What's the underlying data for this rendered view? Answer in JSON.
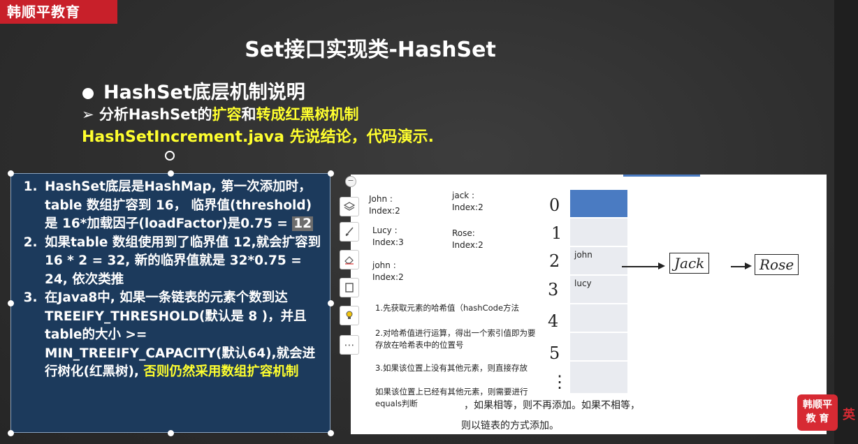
{
  "brand": {
    "logo_text": "韩顺平教育",
    "watermark_line1": "韩顺平",
    "watermark_line2": "教 育",
    "watermark_side": "英"
  },
  "slide": {
    "title": "Set接口实现类-HashSet",
    "bullet": "HashSet底层机制说明",
    "sub_prefix": "➢ 分析HashSet的",
    "sub_kw1": "扩容",
    "sub_mid": "和",
    "sub_kw2": "转成红黑树机制",
    "code_line": "HashSetIncrement.java  先说结论，代码演示."
  },
  "textbox": {
    "item1_a": "HashSet底层是HashMap, 第一次添加时，table 数组扩容到 16， 临界值(threshold)是 16*加载因子(loadFactor)是0.75 = ",
    "item1_highlight": "12",
    "item2": "如果table 数组使用到了临界值 12,就会扩容到 16 * 2 = 32, 新的临界值就是 32*0.75 = 24, 依次类推",
    "item3_a": "在Java8中, 如果一条链表的元素个数到达 TREEIFY_THRESHOLD(默认是 8 )，并且table的大小 >= MIN_TREEIFY_CAPACITY(默认64),就会进行树化(红黑树), ",
    "item3_yellow": "否则仍然采用数组扩容机制"
  },
  "panel": {
    "notes_left": [
      {
        "name": "John :",
        "index": "Index:2"
      },
      {
        "name": "Lucy :",
        "index": "Index:3"
      },
      {
        "name": "john :",
        "index": "Index:2"
      }
    ],
    "notes_right": [
      {
        "name": "jack :",
        "index": "Index:2"
      },
      {
        "name": "Rose:",
        "index": "Index:2"
      }
    ],
    "steps": [
      "1.先获取元素的哈希值（hashCode方法",
      "2.对哈希值进行运算，得出一个索引值即为要存放在哈希表中的位置号",
      "3.如果该位置上没有其他元素，则直接存放",
      "如果该位置上已经有其他元素，则需要进行equals判断"
    ],
    "steps_tail1": "，如果相等，则不再添加。如果不相等，",
    "steps_tail2": "则以链表的方式添加。",
    "indices": [
      "0",
      "1",
      "2",
      "3",
      "4",
      "5",
      "⋮"
    ],
    "cells": [
      "",
      "",
      "john",
      "lucy",
      "",
      "",
      ""
    ],
    "chain": [
      "Jack",
      "Rose"
    ]
  },
  "toolbar": {
    "collapse_symbol": "−",
    "more_symbol": "⋯"
  },
  "colors": {
    "accent_blue": "#4a7bc2",
    "brand_red": "#c8202a",
    "highlight_yellow": "#ffff2e",
    "textbox_bg": "#1c3a5c"
  }
}
